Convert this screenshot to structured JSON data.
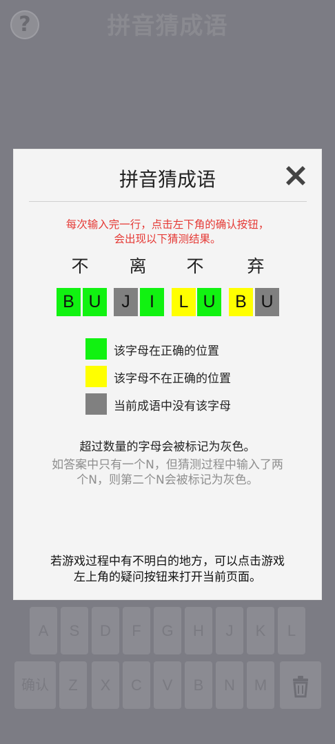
{
  "app": {
    "title": "拼音猜成语",
    "help_label": "?"
  },
  "modal": {
    "title": "拼音猜成语",
    "instruction_line1": "每次输入完一行，点击左下角的确认按钮，",
    "instruction_line2": "会出现以下猜测结果。",
    "hanzi": [
      "不",
      "离",
      "不",
      "弃"
    ],
    "tiles": [
      {
        "letter": "B",
        "status": "correct"
      },
      {
        "letter": "U",
        "status": "correct"
      },
      {
        "letter": "J",
        "status": "absent"
      },
      {
        "letter": "I",
        "status": "correct"
      },
      {
        "letter": "L",
        "status": "present"
      },
      {
        "letter": "U",
        "status": "correct"
      },
      {
        "letter": "B",
        "status": "present"
      },
      {
        "letter": "U",
        "status": "absent"
      }
    ],
    "legend": [
      {
        "color": "#11f211",
        "text": "该字母在正确的位置"
      },
      {
        "color": "#ffff00",
        "text": "该字母不在正确的位置"
      },
      {
        "color": "#808080",
        "text": "当前成语中没有该字母"
      }
    ],
    "note_excess": "超过数量的字母会被标记为灰色。",
    "note_example_line1": "如答案中只有一个N，但猜测过程中输入了两",
    "note_example_line2": "个N，则第二个N会被标记为灰色。",
    "note_help_line1": "若游戏过程中有不明白的地方，可以点击游戏",
    "note_help_line2": "左上角的疑问按钮来打开当前页面。"
  },
  "keyboard": {
    "row1": [
      "A",
      "S",
      "D",
      "F",
      "G",
      "H",
      "J",
      "K",
      "L"
    ],
    "confirm_label": "确认",
    "row2": [
      "Z",
      "X",
      "C",
      "V",
      "B",
      "N",
      "M"
    ],
    "delete_icon": "trash-icon"
  },
  "colors": {
    "correct": "#11f211",
    "present": "#ffff00",
    "absent": "#808080",
    "instruction": "#e53935"
  }
}
